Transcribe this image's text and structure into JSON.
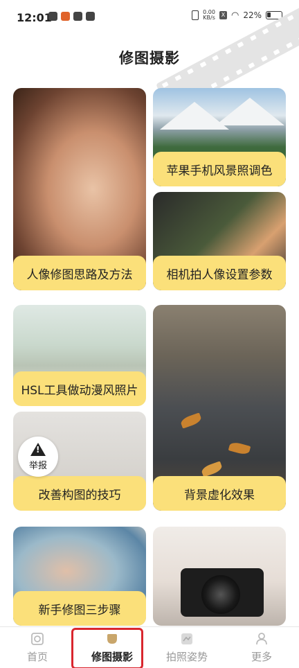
{
  "status_bar": {
    "time": "12:01",
    "net_speed": "0.00",
    "net_unit": "KB/s",
    "sim": "X",
    "battery": "22%"
  },
  "page_title": "修图摄影",
  "cards": {
    "portrait": "人像修图思路及方法",
    "apple": "苹果手机风景照调色",
    "camera": "相机拍人像设置参数",
    "hsl": "HSL工具做动漫风照片",
    "composition": "改善构图的技巧",
    "bokeh": "背景虚化效果",
    "three_steps": "新手修图三步骤"
  },
  "report_button": "举报",
  "nav": {
    "home": "首页",
    "retouch": "修图摄影",
    "pose": "拍照姿势",
    "more": "更多"
  },
  "colors": {
    "label_bg": "#fbe07a",
    "highlight": "#d9262e"
  }
}
